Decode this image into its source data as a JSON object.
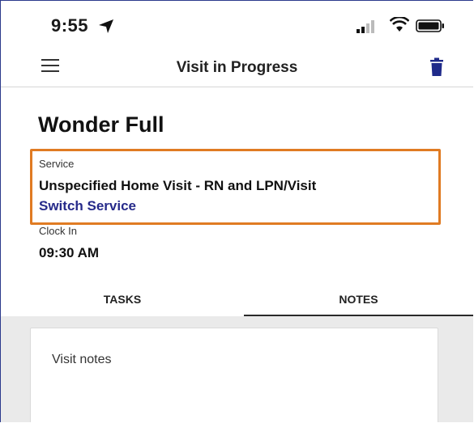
{
  "status_bar": {
    "time": "9:55",
    "location_icon": "location-arrow-icon",
    "signal_icon": "cellular-signal-icon",
    "wifi_icon": "wifi-icon",
    "battery_icon": "battery-icon"
  },
  "header": {
    "title": "Visit in Progress",
    "menu_icon": "hamburger-menu-icon",
    "delete_icon": "trash-icon"
  },
  "visit": {
    "patient_name": "Wonder Full",
    "service_label": "Service",
    "service_value": "Unspecified Home Visit - RN and LPN/Visit",
    "switch_service": "Switch Service",
    "clock_in_label": "Clock In",
    "clock_in_value": "09:30 AM"
  },
  "tabs": [
    {
      "label": "TASKS",
      "active": false
    },
    {
      "label": "NOTES",
      "active": true
    }
  ],
  "notes": {
    "placeholder": "Visit notes"
  },
  "colors": {
    "highlight_border": "#e07b23",
    "link": "#262a8a",
    "trash": "#1f2a8a",
    "notes_bg": "#eaeaea"
  }
}
